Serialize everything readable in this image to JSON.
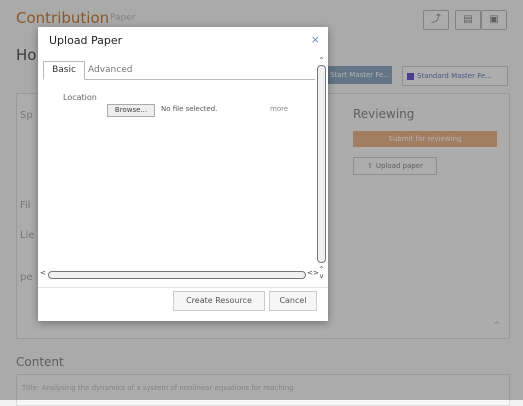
{
  "background": {
    "title": "Contribution",
    "subtitle": "Paper",
    "toolbar_icons": [
      "chart-icon",
      "doc-icon",
      "save-icon"
    ],
    "heading": "Ho",
    "btn_a_label": "Start Master Fe...",
    "btn_b_label": "Standard Master Fe...",
    "reviewing_label": "Reviewing",
    "orange_btn_label": "Submit for reviewing",
    "upload_btn_label": "Upload paper",
    "side_labels": [
      "Sp",
      "Fil",
      "Lie",
      "pe"
    ],
    "content_label": "Content",
    "content_text": "Title: Analysing the dynamics of a system of nonlinear equations for reaching"
  },
  "modal": {
    "title": "Upload Paper",
    "close_glyph": "×",
    "tabs": [
      {
        "label": "Basic",
        "active": true
      },
      {
        "label": "Advanced",
        "active": false
      }
    ],
    "location_label": "Location",
    "browse_label": "Browse...",
    "file_status": "No file selected.",
    "more_label": "more",
    "create_label": "Create Resource",
    "cancel_label": "Cancel"
  }
}
